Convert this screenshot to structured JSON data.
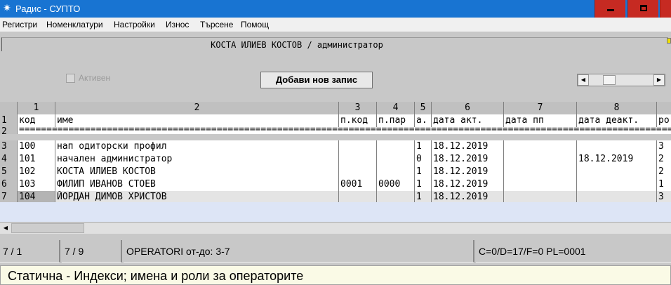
{
  "window": {
    "title": "Радис - СУПТО",
    "icon": "radis-app-icon"
  },
  "menu": [
    "Регистри",
    "Номенклатури",
    "Настройки",
    "Износ",
    "Търсене",
    "Помощ"
  ],
  "header": {
    "user_line": "КОСТА ИЛИЕВ КОСТОВ / администратор"
  },
  "controls": {
    "active_label": "Активен",
    "active_checked": false,
    "add_button": "Добави нов запис"
  },
  "grid": {
    "col_numbers": [
      "",
      "1",
      "2",
      "3",
      "4",
      "5",
      "6",
      "7",
      "8",
      ""
    ],
    "col_headers": [
      "код",
      "име",
      "п.код",
      "п.пар",
      "а.",
      "дата акт.",
      "дата пп",
      "дата деакт.",
      "ро"
    ],
    "row_numbers": [
      "1",
      "2",
      "3",
      "4",
      "5",
      "6",
      "7"
    ],
    "separator": "========================================================================================================================================",
    "rows": [
      {
        "kod": "100",
        "ime": "нап одиторски профил",
        "pkod": "",
        "ppar": "",
        "a": "1",
        "data_akt": "18.12.2019",
        "data_pp": "",
        "data_deakt": "",
        "rol": "3"
      },
      {
        "kod": "101",
        "ime": "начален администратор",
        "pkod": "",
        "ppar": "",
        "a": "0",
        "data_akt": "18.12.2019",
        "data_pp": "",
        "data_deakt": "18.12.2019",
        "rol": "2"
      },
      {
        "kod": "102",
        "ime": "КОСТА ИЛИЕВ КОСТОВ",
        "pkod": "",
        "ppar": "",
        "a": "1",
        "data_akt": "18.12.2019",
        "data_pp": "",
        "data_deakt": "",
        "rol": "2"
      },
      {
        "kod": "103",
        "ime": "ФИЛИП ИВАНОВ СТОЕВ",
        "pkod": "0001",
        "ppar": "0000",
        "a": "1",
        "data_akt": "18.12.2019",
        "data_pp": "",
        "data_deakt": "",
        "rol": "1"
      },
      {
        "kod": "104",
        "ime": "ЙОРДАН ДИМОВ ХРИСТОВ",
        "pkod": "",
        "ppar": "",
        "a": "1",
        "data_akt": "18.12.2019",
        "data_pp": "",
        "data_deakt": "",
        "rol": "3"
      }
    ]
  },
  "status": {
    "pos": "7 / 1",
    "count": "7 / 9",
    "table": "OPERATORI от-до: 3-7",
    "info": "C=0/D=17/F=0 PL=0001"
  },
  "hint": "Статична - Индекси; имена и роли за операторите",
  "colors": {
    "titlebar": "#1874d2",
    "window_buttons": "#c62a22",
    "grid_blank": "#dde5f6",
    "hint_bg": "#fafae6"
  }
}
